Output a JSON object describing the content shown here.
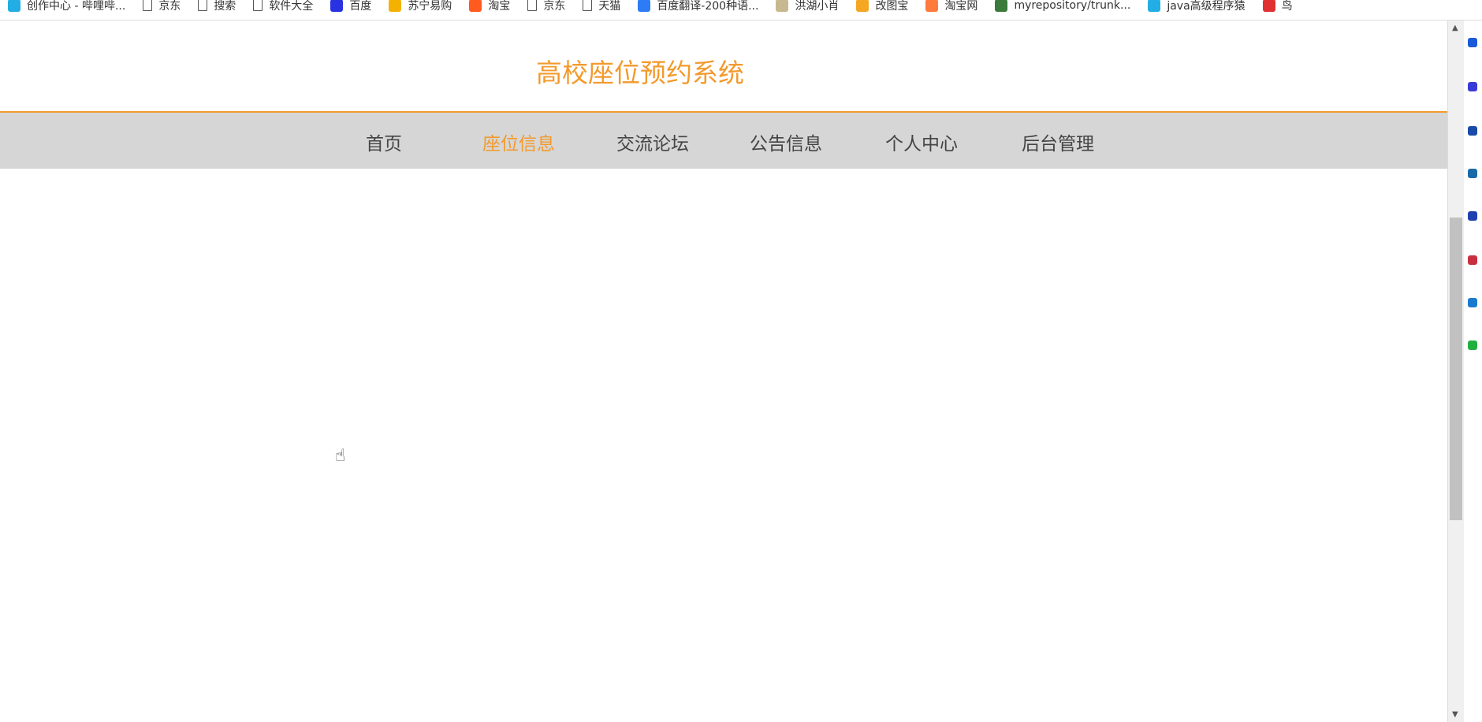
{
  "bookmarks": [
    {
      "label": "创作中心 - 哔哩哔...",
      "icon": "bilibili-icon",
      "color": "#23ade5"
    },
    {
      "label": "京东",
      "icon": "page-icon"
    },
    {
      "label": "搜索",
      "icon": "page-icon"
    },
    {
      "label": "软件大全",
      "icon": "page-icon"
    },
    {
      "label": "百度",
      "icon": "baidu-icon",
      "color": "#2932e1"
    },
    {
      "label": "苏宁易购",
      "icon": "suning-icon",
      "color": "#f5b100"
    },
    {
      "label": "淘宝",
      "icon": "taobao-icon",
      "color": "#ff5a1f"
    },
    {
      "label": "京东",
      "icon": "page-icon"
    },
    {
      "label": "天猫",
      "icon": "page-icon"
    },
    {
      "label": "百度翻译-200种语...",
      "icon": "translate-icon",
      "color": "#2d7cf6"
    },
    {
      "label": "洪湖小肖",
      "icon": "avatar-icon",
      "color": "#c8b890"
    },
    {
      "label": "改图宝",
      "icon": "gaitubao-icon",
      "color": "#f5a623"
    },
    {
      "label": "淘宝网",
      "icon": "taobao-icon",
      "color": "#ff7a3d"
    },
    {
      "label": "myrepository/trunk...",
      "icon": "repo-icon",
      "color": "#3a7a3a"
    },
    {
      "label": "java高级程序猿",
      "icon": "bilibili-icon",
      "color": "#23ade5"
    },
    {
      "label": "鸟",
      "icon": "bird-icon",
      "color": "#e03030"
    }
  ],
  "header": {
    "title": "高校座位预约系统"
  },
  "nav": {
    "items": [
      {
        "label": "首页"
      },
      {
        "label": "座位信息",
        "active": true
      },
      {
        "label": "交流论坛"
      },
      {
        "label": "公告信息"
      },
      {
        "label": "个人中心"
      },
      {
        "label": "后台管理"
      }
    ]
  },
  "colors": {
    "accent": "#f39a2c",
    "nav_bg": "#d6d6d6"
  }
}
